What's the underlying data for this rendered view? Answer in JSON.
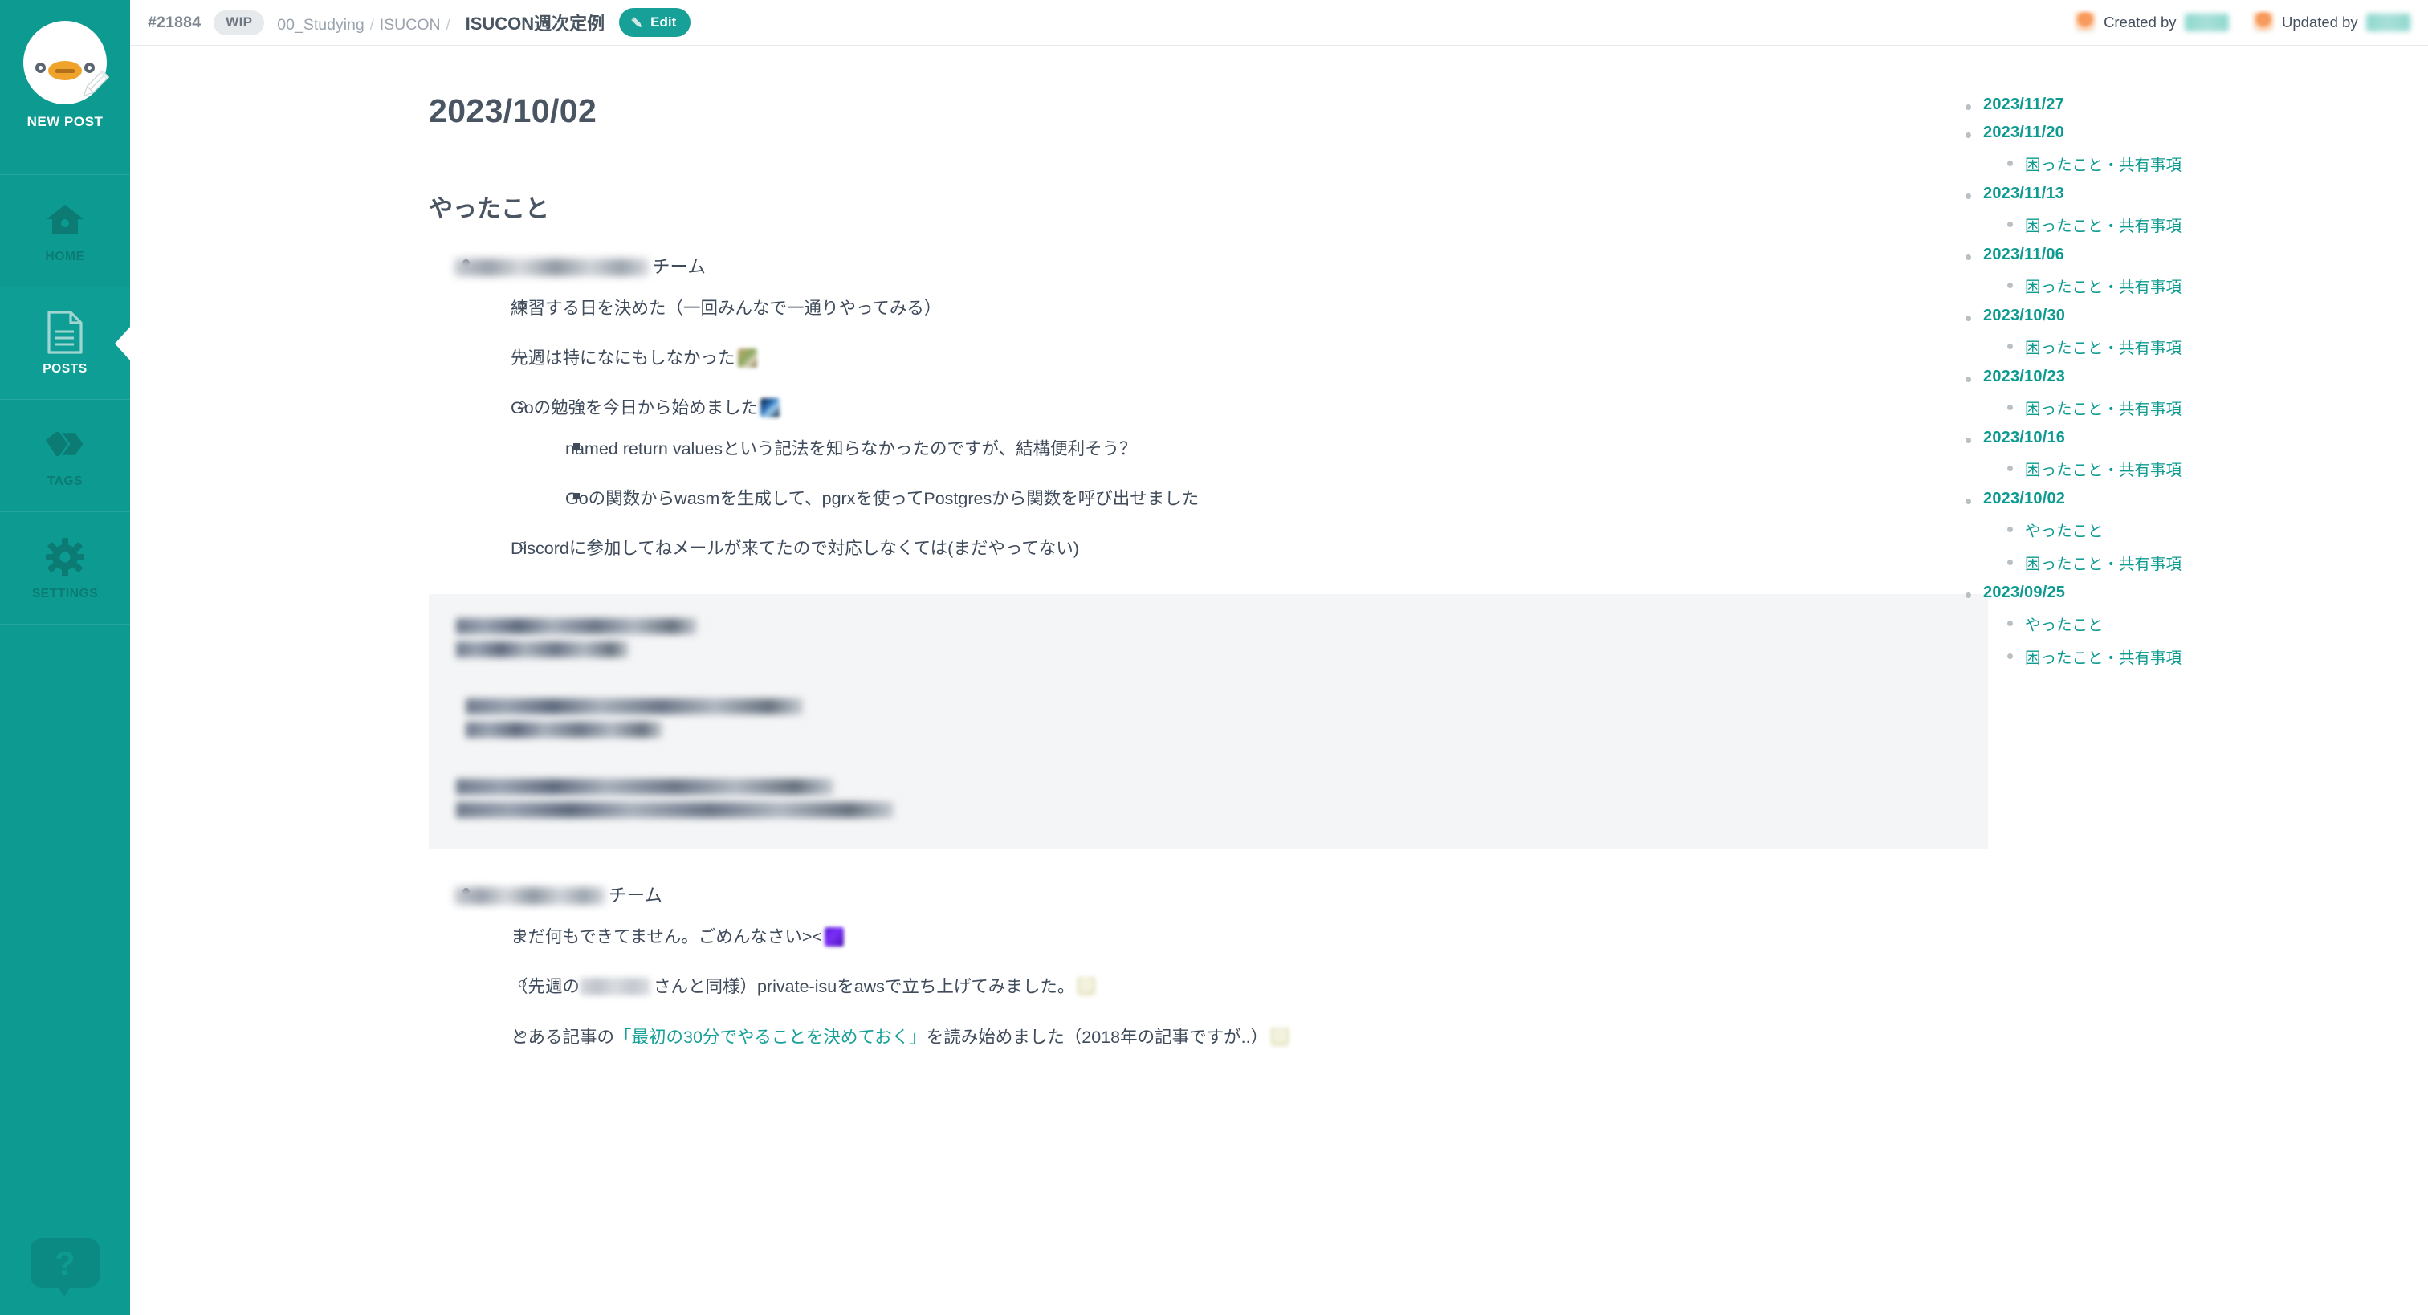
{
  "sidebar": {
    "new_post_label": "NEW POST",
    "items": [
      {
        "label": "HOME",
        "icon": "home-icon",
        "active": false
      },
      {
        "label": "POSTS",
        "icon": "document-icon",
        "active": true
      },
      {
        "label": "TAGS",
        "icon": "tag-icon",
        "active": false
      },
      {
        "label": "SETTINGS",
        "icon": "gear-icon",
        "active": false
      }
    ],
    "help_icon": "help-chat-icon"
  },
  "topbar": {
    "post_number": "#21884",
    "wip_badge": "WIP",
    "breadcrumb": [
      "00_Studying",
      "ISUCON"
    ],
    "breadcrumb_separator": "/",
    "title": "ISUCON週次定例",
    "edit_label": "Edit",
    "created_by_label": "Created by",
    "created_by_name": "redacted",
    "updated_by_label": "Updated by",
    "updated_by_name": "redacted"
  },
  "article": {
    "title": "2023/10/02",
    "section_heading": "やったこと",
    "team1": {
      "name_redacted": "redacted",
      "suffix": "チーム",
      "items": [
        {
          "text": "練習する日を決めた（一回みんなで一通りやってみる）"
        },
        {
          "text": "先週は特になにもしなかった",
          "emoji": "plant-emoji"
        },
        {
          "text": "Goの勉強を今日から始めました",
          "emoji": "gopher-emoji",
          "children": [
            {
              "text": "named return valuesという記法を知らなかったのですが、結構便利そう？"
            },
            {
              "text": "Goの関数からwasmを生成して、pgrxを使ってPostgresから関数を呼び出せました"
            }
          ]
        },
        {
          "text": "Discordに参加してねメールが来てたので対応しなくては(まだやってない)"
        }
      ]
    },
    "codeblock_redacted": [
      "line-1",
      "line-2",
      "line-3",
      "line-4",
      "line-5",
      "line-6"
    ],
    "team2": {
      "name_redacted": "redacted",
      "suffix": "チーム",
      "items": [
        {
          "text": "まだ何もできてません。ごめんなさい><",
          "emoji": "purple-emoji"
        },
        {
          "prefix": "（先週の",
          "redacted": "redacted",
          "text": "さんと同様）private-isuをawsで立ち上げてみました。",
          "emoji": "pale-emoji"
        },
        {
          "prefix": "とある記事の",
          "link": "「最初の30分でやることを決めておく」",
          "text": "を読み始めました（2018年の記事ですが..）",
          "emoji": "pale-emoji"
        }
      ]
    }
  },
  "toc": {
    "entries": [
      {
        "label": "2023/11/27",
        "children": []
      },
      {
        "label": "2023/11/20",
        "children": [
          "困ったこと・共有事項"
        ]
      },
      {
        "label": "2023/11/13",
        "children": [
          "困ったこと・共有事項"
        ]
      },
      {
        "label": "2023/11/06",
        "children": [
          "困ったこと・共有事項"
        ]
      },
      {
        "label": "2023/10/30",
        "children": [
          "困ったこと・共有事項"
        ]
      },
      {
        "label": "2023/10/23",
        "children": [
          "困ったこと・共有事項"
        ]
      },
      {
        "label": "2023/10/16",
        "children": [
          "困ったこと・共有事項"
        ]
      },
      {
        "label": "2023/10/02",
        "children": [
          "やったこと",
          "困ったこと・共有事項"
        ]
      },
      {
        "label": "2023/09/25",
        "children": [
          "やったこと",
          "困ったこと・共有事項"
        ]
      }
    ]
  },
  "colors": {
    "brand_teal": "#0d9a90",
    "accent_teal": "#16a097",
    "text_dark": "#3f4b5b",
    "muted": "#9aa3ac"
  }
}
